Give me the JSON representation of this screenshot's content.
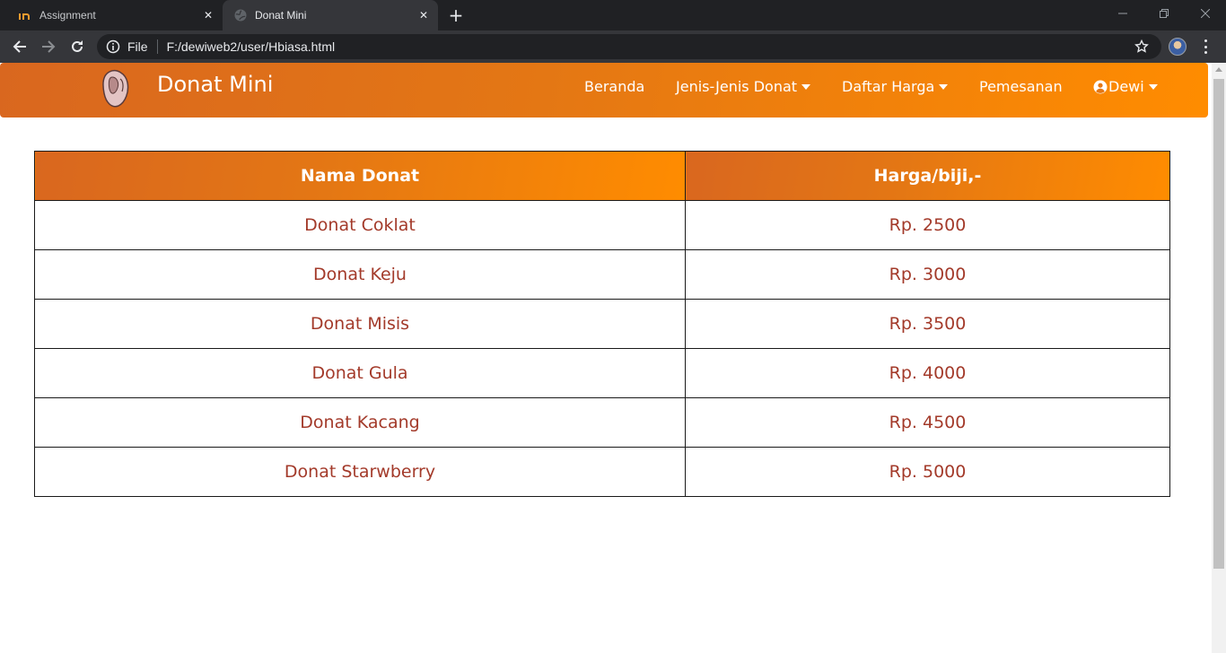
{
  "browser": {
    "tabs": [
      {
        "title": "Assignment",
        "active": false
      },
      {
        "title": "Donat Mini",
        "active": true
      }
    ],
    "address": {
      "scheme": "File",
      "url": "F:/dewiweb2/user/Hbiasa.html"
    }
  },
  "navbar": {
    "brand": "Donat Mini",
    "items": [
      {
        "label": "Beranda",
        "dropdown": false
      },
      {
        "label": "Jenis-Jenis Donat",
        "dropdown": true
      },
      {
        "label": "Daftar Harga",
        "dropdown": true
      },
      {
        "label": "Pemesanan",
        "dropdown": false
      },
      {
        "label": "Dewi",
        "dropdown": true,
        "icon": "user-circle-icon"
      }
    ]
  },
  "table": {
    "headers": [
      "Nama Donat",
      "Harga/biji,-"
    ],
    "rows": [
      {
        "name": "Donat Coklat",
        "price": "Rp. 2500"
      },
      {
        "name": "Donat Keju",
        "price": "Rp. 3000"
      },
      {
        "name": "Donat Misis",
        "price": "Rp. 3500"
      },
      {
        "name": "Donat Gula",
        "price": "Rp. 4000"
      },
      {
        "name": "Donat Kacang",
        "price": "Rp. 4500"
      },
      {
        "name": "Donat Starwberry",
        "price": "Rp. 5000"
      }
    ]
  },
  "colors": {
    "accent_start": "#d9671f",
    "accent_end": "#ff8c00",
    "cell_text": "#a33a2a"
  }
}
